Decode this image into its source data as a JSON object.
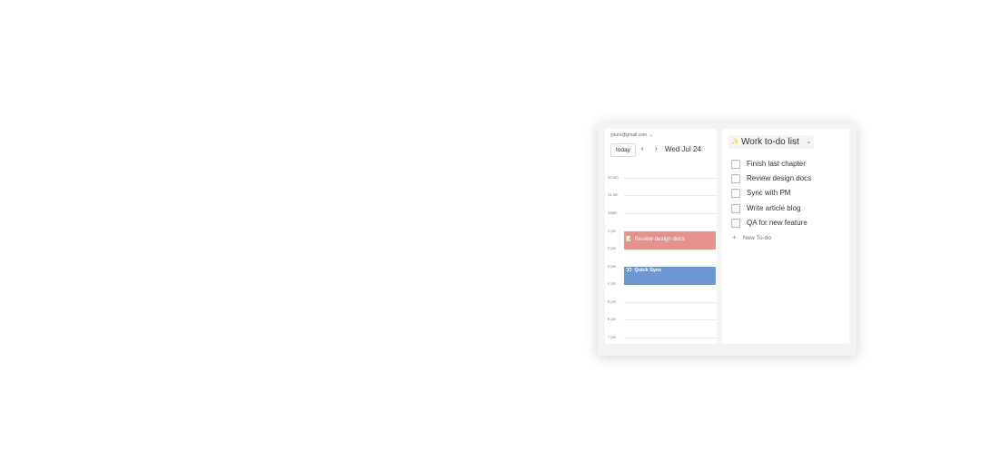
{
  "calendar": {
    "account": "yours@gmail.com",
    "account_caret": "⌄",
    "today_label": "today",
    "prev_icon": "‹",
    "next_icon": "›",
    "date_label": "Wed Jul 24",
    "hours": [
      "10 am",
      "11 am",
      "12pm",
      "1 pm",
      "2 pm",
      "3 pm",
      "4 pm",
      "5 pm",
      "6 pm",
      "7 pm"
    ],
    "events": [
      {
        "emoji": "📝",
        "title": "Review design docs",
        "color": "#e4928b"
      },
      {
        "emoji": "👀",
        "title": "Quick Sync",
        "color": "#6f97d6"
      }
    ]
  },
  "todo": {
    "list_emoji": "✨",
    "list_title": "Work to-do list",
    "chevron": "⌄",
    "items": [
      {
        "label": "Finish last chapter",
        "checked": false
      },
      {
        "label": "Review design docs",
        "checked": false
      },
      {
        "label": "Sync with PM",
        "checked": false
      },
      {
        "label": "Write article blog",
        "checked": false
      },
      {
        "label": "QA for new feature",
        "checked": false
      }
    ],
    "new_icon": "+",
    "new_label": "New To-do"
  }
}
